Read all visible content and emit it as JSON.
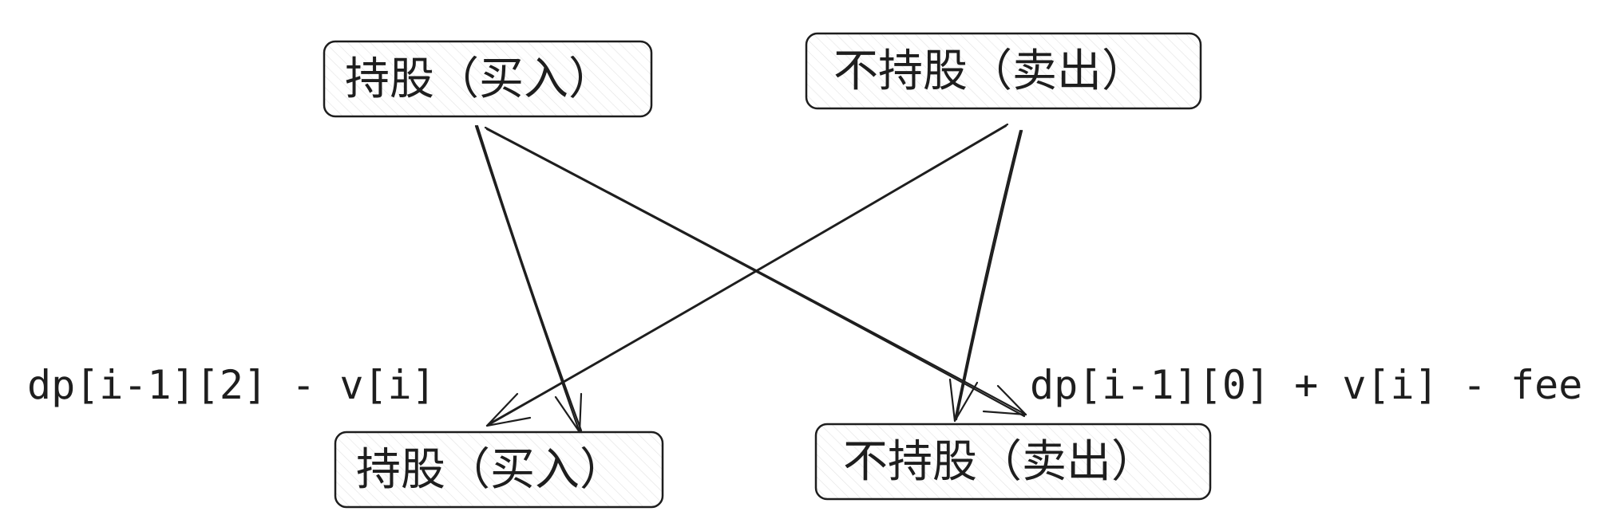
{
  "nodes": {
    "top_left": {
      "label": "持股（买入）"
    },
    "top_right": {
      "label": "不持股（卖出）"
    },
    "bottom_left": {
      "label": "持股（买入）"
    },
    "bottom_right": {
      "label": "不持股（卖出）"
    }
  },
  "formulas": {
    "buy": "dp[i-1][2] - v[i]",
    "sell": "dp[i-1][0] + v[i] - fee"
  }
}
